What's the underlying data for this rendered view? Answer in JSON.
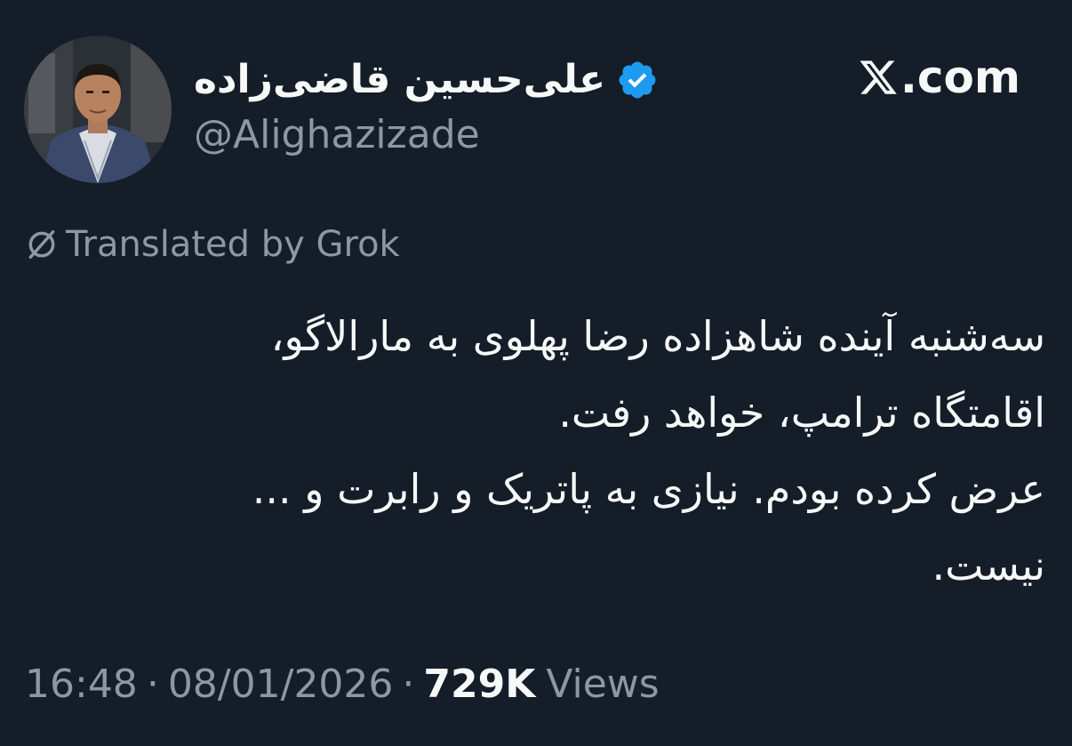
{
  "author": {
    "display_name": "علی‌حسین قاضی‌زاده",
    "handle": "@Alighazizade",
    "verified": true,
    "avatar_icon": "avatar-photo"
  },
  "source": {
    "brand_label": ".com",
    "logo_icon": "x-logo-icon"
  },
  "translation": {
    "label": "Translated by Grok",
    "icon": "grok-icon"
  },
  "tweet": {
    "lines": [
      "سه‌شنبه آینده شاهزاده رضا پهلوی به مارالاگو،",
      "اقامتگاه ترامپ، خواهد رفت.",
      "عرض کرده بودم. نیازی به پاتریک و رابرت و ...",
      "نیست."
    ]
  },
  "meta": {
    "time": "16:48",
    "separator": "·",
    "date": "08/01/2026",
    "views_count": "729K",
    "views_label": "Views"
  },
  "colors": {
    "background": "#151d28",
    "text_primary": "#f7f9f9",
    "text_secondary": "#8b98a5",
    "verified_badge": "#1d9bf0"
  }
}
